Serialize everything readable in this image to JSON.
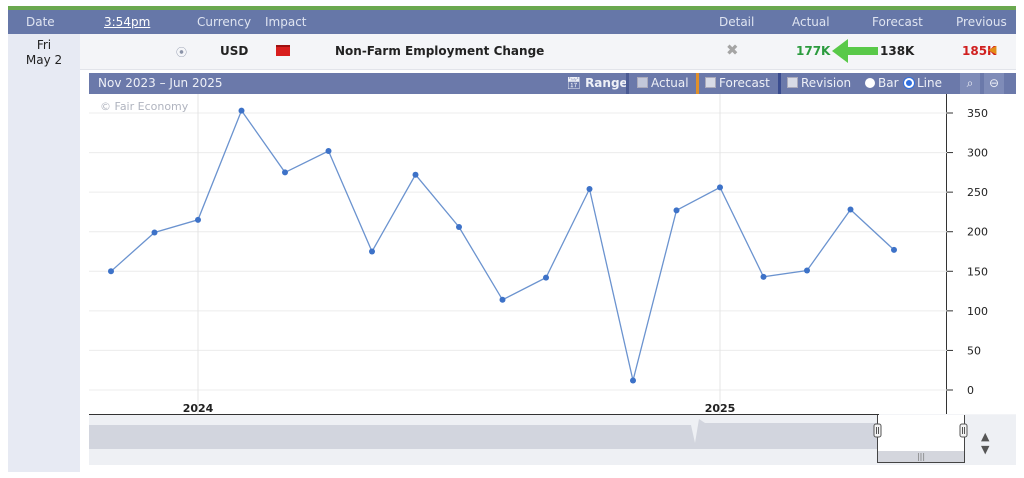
{
  "header": {
    "date": "Date",
    "time": "3:54pm",
    "currency": "Currency",
    "impact": "Impact",
    "detail": "Detail",
    "actual": "Actual",
    "forecast": "Forecast",
    "previous": "Previous"
  },
  "row": {
    "day": "Fri",
    "date": "May 2",
    "currency": "USD",
    "event": "Non-Farm Employment Change",
    "actual": "177K",
    "forecast": "138K",
    "previous": "185K",
    "actual_color": "#2b9b3e",
    "previous_color": "#d01f1f",
    "impact_color": "#d81e1e",
    "sound_icon": "sound-icon",
    "detail_icon": "close-x-icon",
    "arrow_icon": "green-arrow-icon",
    "revision_arrow_icon": "revision-arrow-icon"
  },
  "toolbar": {
    "range_text": "Nov 2023 – Jun 2025",
    "range_btn": "Range",
    "actual": "Actual",
    "forecast": "Forecast",
    "revision": "Revision",
    "bar": "Bar",
    "line": "Line",
    "selected_view": "Line"
  },
  "watermark": "© Fair Economy",
  "chart_data": {
    "type": "line",
    "series": [
      {
        "values": [
          [
            "2023-11",
            150
          ],
          [
            "2023-12",
            199
          ],
          [
            "2024-01",
            215
          ],
          [
            "2024-02",
            353
          ],
          [
            "2024-03",
            275
          ],
          [
            "2024-04",
            302
          ],
          [
            "2024-05",
            175
          ],
          [
            "2024-06",
            272
          ],
          [
            "2024-07",
            206
          ],
          [
            "2024-08",
            114
          ],
          [
            "2024-09",
            142
          ],
          [
            "2024-10",
            254
          ],
          [
            "2024-11",
            12
          ],
          [
            "2024-12",
            227
          ],
          [
            "2025-01",
            256
          ],
          [
            "2025-02",
            143
          ],
          [
            "2025-03",
            151
          ],
          [
            "2025-04",
            228
          ],
          [
            "2025-05",
            177
          ]
        ],
        "color": "#6b93cf"
      }
    ],
    "yticks": [
      0,
      50,
      100,
      150,
      200,
      250,
      300,
      350
    ],
    "xticks": [
      "2024",
      "2025"
    ],
    "ylim": [
      0,
      350
    ],
    "grid": true
  }
}
